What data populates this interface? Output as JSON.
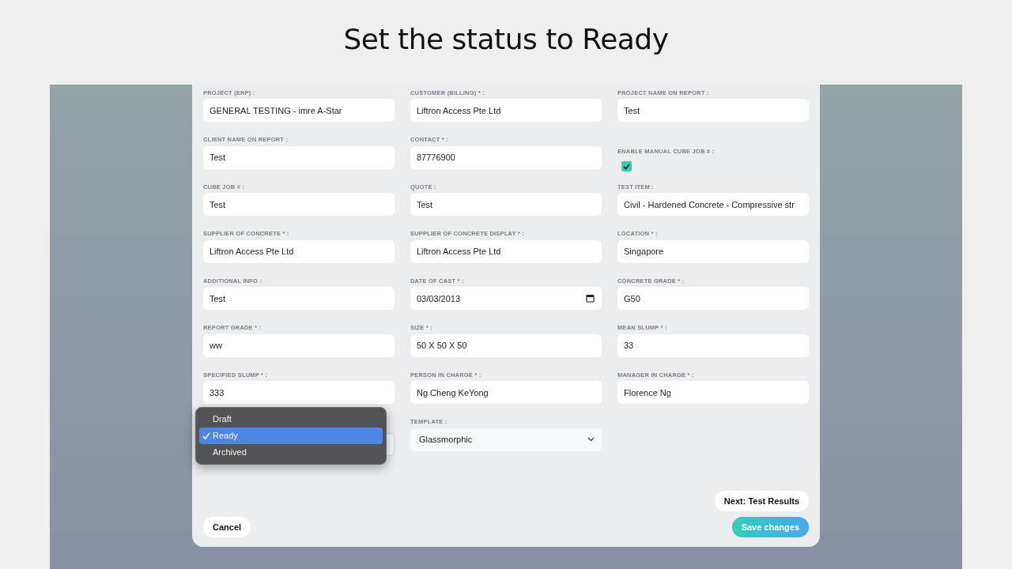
{
  "heading": "Set the status to Ready",
  "fields": [
    {
      "kind": "text",
      "label": "PROJECT (ERP) :",
      "value": "GENERAL TESTING - imre A-Star"
    },
    {
      "kind": "text",
      "label": "CUSTOMER (BILLING) * :",
      "value": "Liftron Access Pte Ltd"
    },
    {
      "kind": "text",
      "label": "PROJECT NAME ON REPORT :",
      "value": "Test"
    },
    {
      "kind": "text",
      "label": "CLIENT NAME ON REPORT :",
      "value": "Test"
    },
    {
      "kind": "text",
      "label": "CONTACT * :",
      "value": "87776900"
    },
    {
      "kind": "checkbox",
      "label": "ENABLE MANUAL CUBE JOB # :",
      "checked": true
    },
    {
      "kind": "text",
      "label": "CUBE JOB # :",
      "value": "Test"
    },
    {
      "kind": "text",
      "label": "QUOTE :",
      "value": "Test"
    },
    {
      "kind": "text",
      "label": "TEST ITEM :",
      "value": "Civil - Hardened Concrete - Compressive str"
    },
    {
      "kind": "text",
      "label": "SUPPLIER OF CONCRETE * :",
      "value": "Liftron Access Pte Ltd"
    },
    {
      "kind": "text",
      "label": "SUPPLIER OF CONCRETE DISPLAY * :",
      "value": "Liftron Access Pte Ltd"
    },
    {
      "kind": "text",
      "label": "LOCATION * :",
      "value": "Singapore"
    },
    {
      "kind": "text",
      "label": "ADDITIONAL INFO :",
      "value": "Test"
    },
    {
      "kind": "date",
      "label": "DATE OF CAST * :",
      "value": "03/03/2013"
    },
    {
      "kind": "text",
      "label": "CONCRETE GRADE * :",
      "value": "G50"
    },
    {
      "kind": "text",
      "label": "REPORT GRADE * :",
      "value": "ww"
    },
    {
      "kind": "text",
      "label": "SIZE * :",
      "value": "50 X 50 X 50"
    },
    {
      "kind": "text",
      "label": "MEAN SLUMP * :",
      "value": "33"
    },
    {
      "kind": "text",
      "label": "SPECIFIED SLUMP * :",
      "value": "333"
    },
    {
      "kind": "text",
      "label": "PERSON IN CHARGE * :",
      "value": "Ng Cheng KeYong"
    },
    {
      "kind": "text",
      "label": "MANAGER IN CHARGE * :",
      "value": "Florence Ng"
    },
    {
      "kind": "open-select",
      "options": [
        {
          "label": "Draft",
          "selected": false
        },
        {
          "label": "Ready",
          "selected": true
        },
        {
          "label": "Archived",
          "selected": false
        }
      ]
    },
    {
      "kind": "select",
      "label": "TEMPLATE :",
      "value": "Glassmorphic"
    }
  ],
  "buttons": {
    "cancel": "Cancel",
    "next": "Next: Test Results",
    "save": "Save changes"
  }
}
